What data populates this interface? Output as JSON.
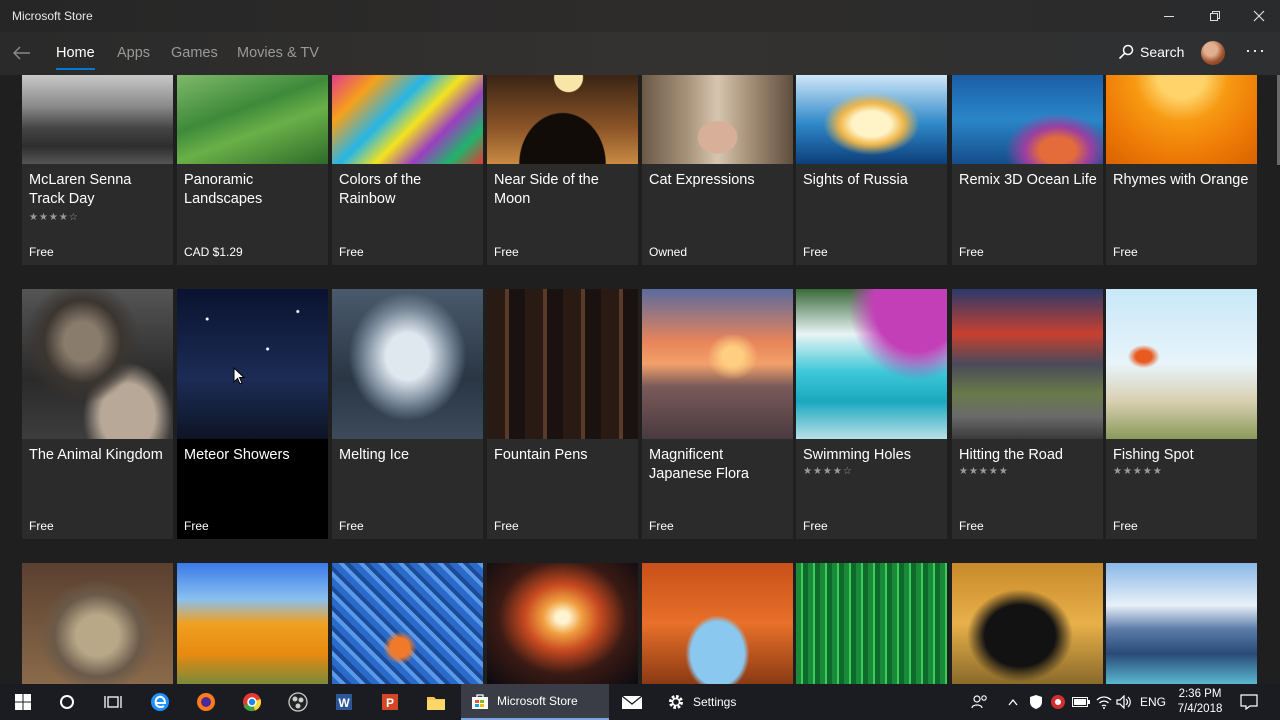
{
  "window": {
    "title": "Microsoft Store",
    "minimize_icon": "minimize-icon",
    "maximize_icon": "restore-icon",
    "close_icon": "close-icon"
  },
  "nav": {
    "tabs": [
      {
        "label": "Home",
        "active": true
      },
      {
        "label": "Apps",
        "active": false
      },
      {
        "label": "Games",
        "active": false
      },
      {
        "label": "Movies & TV",
        "active": false
      }
    ],
    "search_label": "Search",
    "accent_color": "#0078d7"
  },
  "tiles_row1": [
    {
      "name": "McLaren Senna Track Day",
      "rating": "★★★★☆",
      "price": "Free"
    },
    {
      "name": "Panoramic Landscapes",
      "rating": "",
      "price": "CAD $1.29"
    },
    {
      "name": "Colors of the Rainbow",
      "rating": "",
      "price": "Free"
    },
    {
      "name": "Near Side of the Moon",
      "rating": "",
      "price": "Free"
    },
    {
      "name": "Cat Expressions",
      "rating": "",
      "price": "Owned"
    },
    {
      "name": "Sights of Russia",
      "rating": "",
      "price": "Free"
    },
    {
      "name": "Remix 3D Ocean Life",
      "rating": "",
      "price": "Free"
    },
    {
      "name": "Rhymes with Orange",
      "rating": "",
      "price": "Free"
    }
  ],
  "tiles_row2": [
    {
      "name": "The Animal Kingdom",
      "rating": "",
      "price": "Free"
    },
    {
      "name": "Meteor Showers",
      "rating": "",
      "price": "Free"
    },
    {
      "name": "Melting Ice",
      "rating": "",
      "price": "Free"
    },
    {
      "name": "Fountain Pens",
      "rating": "",
      "price": "Free"
    },
    {
      "name": "Magnificent Japanese Flora",
      "rating": "",
      "price": "Free"
    },
    {
      "name": "Swimming Holes",
      "rating": "★★★★☆",
      "price": "Free"
    },
    {
      "name": "Hitting the Road",
      "rating": "★★★★★",
      "price": "Free"
    },
    {
      "name": "Fishing Spot",
      "rating": "★★★★★",
      "price": "Free"
    }
  ],
  "taskbar": {
    "active_app": "Microsoft Store",
    "settings_app": "Settings",
    "language": "ENG",
    "time": "2:36 PM",
    "date": "7/4/2018"
  }
}
